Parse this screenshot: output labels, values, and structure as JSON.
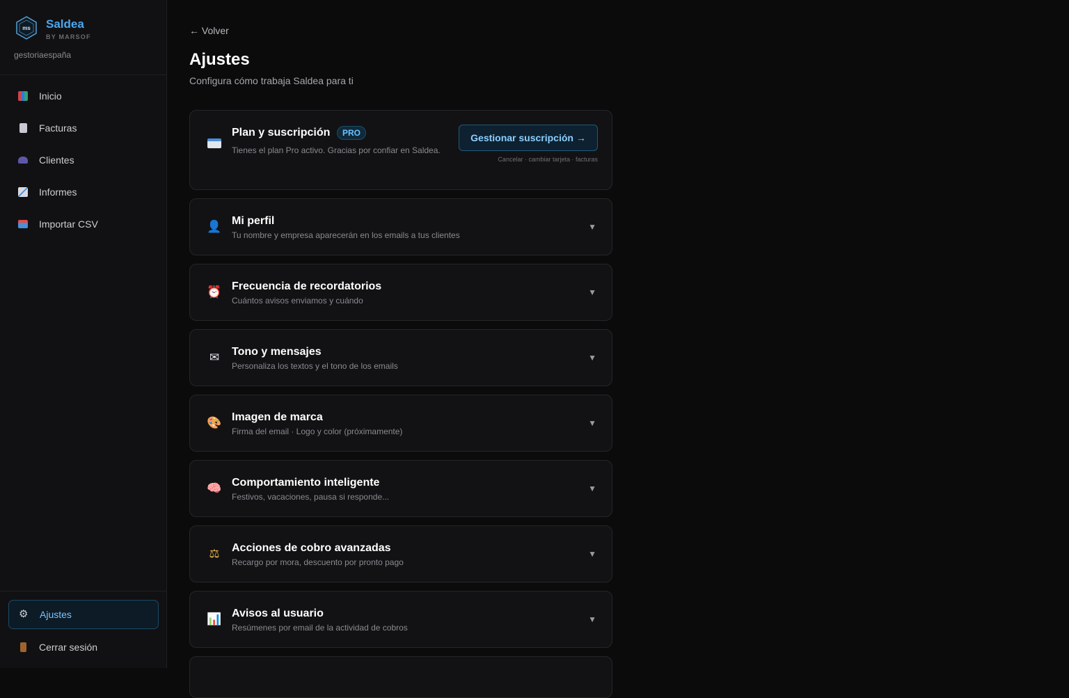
{
  "brand": {
    "name": "Saldea",
    "subtitle": "BY MARSOF",
    "user": "gestoriaespaña",
    "logo_text": "ms"
  },
  "nav": [
    {
      "label": "Inicio",
      "icon": "bar-chart-icon",
      "color": "#3b82f6"
    },
    {
      "label": "Facturas",
      "icon": "document-icon",
      "color": "#c9c9d4"
    },
    {
      "label": "Clientes",
      "icon": "users-icon",
      "color": "#6c63b8"
    },
    {
      "label": "Informes",
      "icon": "trend-chart-icon",
      "color": "#c9c9d4"
    },
    {
      "label": "Importar CSV",
      "icon": "inbox-tray-icon",
      "color": "#4a8fd8"
    }
  ],
  "bottom_nav": {
    "settings": "Ajustes",
    "logout": "Cerrar sesión"
  },
  "header": {
    "back": "← Volver",
    "title": "Ajustes",
    "subtitle": "Configura cómo trabaja Saldea para ti"
  },
  "plan": {
    "title": "Plan y suscripción",
    "badge": "PRO",
    "desc": "Tienes el plan Pro activo. Gracias por confiar en Saldea.",
    "button": "Gestionar suscripción →",
    "note": "Cancelar · cambiar tarjeta · facturas",
    "icon": "credit-card-icon"
  },
  "sections": [
    {
      "title": "Mi perfil",
      "desc": "Tu nombre y empresa aparecerán en los emails a tus clientes",
      "icon": "user-silhouette-icon",
      "glyph": "👤"
    },
    {
      "title": "Frecuencia de recordatorios",
      "desc": "Cuántos avisos enviamos y cuándo",
      "icon": "alarm-clock-icon",
      "glyph": "⏰"
    },
    {
      "title": "Tono y mensajes",
      "desc": "Personaliza los textos y el tono de los emails",
      "icon": "envelope-icon",
      "glyph": "✉"
    },
    {
      "title": "Imagen de marca",
      "desc": "Firma del email · Logo y color (próximamente)",
      "icon": "palette-icon",
      "glyph": "🎨"
    },
    {
      "title": "Comportamiento inteligente",
      "desc": "Festivos, vacaciones, pausa si responde...",
      "icon": "brain-icon",
      "glyph": "🧠"
    },
    {
      "title": "Acciones de cobro avanzadas",
      "desc": "Recargo por mora, descuento por pronto pago",
      "icon": "scales-icon",
      "glyph": "⚖"
    },
    {
      "title": "Avisos al usuario",
      "desc": "Resúmenes por email de la actividad de cobros",
      "icon": "bar-chart-icon",
      "glyph": "📊"
    }
  ],
  "chevron": "▼",
  "colors": {
    "accent": "#4aa8f0",
    "background": "#0b0b0c",
    "card": "#121214"
  }
}
